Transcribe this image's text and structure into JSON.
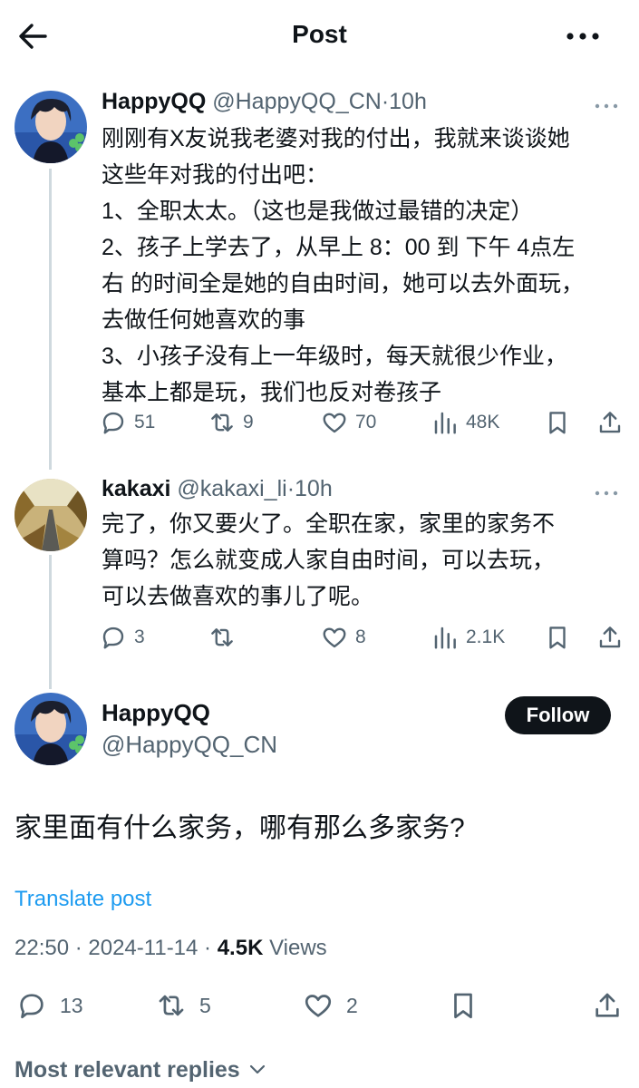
{
  "header": {
    "title": "Post",
    "back_icon": "arrow-left-icon",
    "more_icon": "more-horizontal-icon"
  },
  "tweet1": {
    "name": "HappyQQ",
    "handle": "@HappyQQ_CN",
    "sep": "·",
    "time": "10h",
    "lines": [
      "刚刚有X友说我老婆对我的付出，我就来谈谈她",
      "这些年对我的付出吧：",
      "1、全职太太。（这也是我做过最错的决定）",
      "2、孩子上学去了，从早上 8：00 到 下午 4点左",
      "右 的时间全是她的自由时间，她可以去外面玩，",
      "去做任何她喜欢的事",
      "3、小孩子没有上一年级时，每天就很少作业，",
      "基本上都是玩，我们也反对卷孩子"
    ],
    "replies": "51",
    "reposts": "9",
    "likes": "70",
    "views": "48K"
  },
  "tweet2": {
    "name": "kakaxi",
    "handle": "@kakaxi_li",
    "sep": "·",
    "time": "10h",
    "lines": [
      "完了，你又要火了。全职在家，家里的家务不",
      "算吗？怎么就变成人家自由时间，可以去玩，",
      "可以去做喜欢的事儿了呢。"
    ],
    "replies": "3",
    "reposts": "",
    "likes": "8",
    "views": "2.1K"
  },
  "main_post": {
    "name": "HappyQQ",
    "handle": "@HappyQQ_CN",
    "follow_label": "Follow",
    "text": "家里面有什么家务，哪有那么多家务?",
    "translate_label": "Translate post",
    "time": "22:50",
    "sep1": " · ",
    "date": "2024-11-14",
    "sep2": " · ",
    "views_count": "4.5K",
    "views_label": " Views",
    "replies": "13",
    "reposts": "5",
    "likes": "2"
  },
  "replies_sort": {
    "label": "Most relevant replies"
  },
  "colors": {
    "text_primary": "#0f1419",
    "text_secondary": "#536471",
    "link": "#1d9bf0",
    "thread_line": "#cfd9de",
    "follow_bg": "#0f1419"
  }
}
